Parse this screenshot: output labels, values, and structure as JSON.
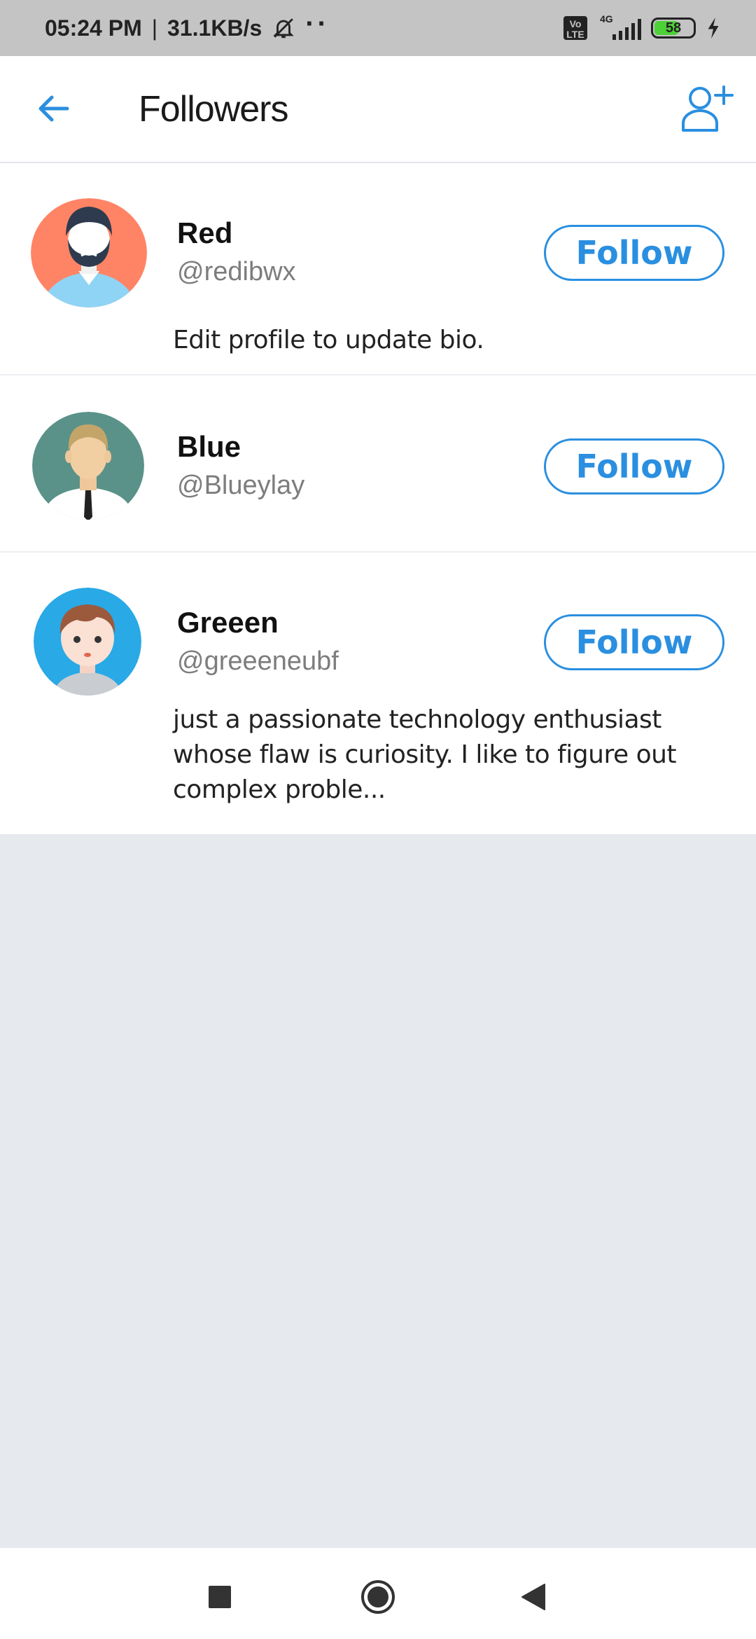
{
  "status_bar": {
    "time": "05:24 PM",
    "separator": "|",
    "speed": "31.1KB/s",
    "network": "4G",
    "volte": "Vo LTE",
    "battery": "58"
  },
  "header": {
    "title": "Followers"
  },
  "followers": [
    {
      "name": "Red",
      "handle": "@redibwx",
      "follow_label": "Follow",
      "bio": "Edit profile to update bio.",
      "avatar_color": "#ff8466"
    },
    {
      "name": "Blue",
      "handle": "@Blueylay",
      "follow_label": "Follow",
      "bio": "",
      "avatar_color": "#5a9289"
    },
    {
      "name": "Greeen",
      "handle": "@greeeneubf",
      "follow_label": "Follow",
      "bio": "just a passionate technology enthusiast whose flaw is curiosity. I like to figure out complex proble...",
      "avatar_color": "#29a9e6"
    }
  ],
  "colors": {
    "accent": "#2a8fe0",
    "background": "#e6eaee",
    "status_bar": "#c4c4c4"
  },
  "icons": {
    "back": "arrow-left-icon",
    "add_user": "add-user-icon",
    "nav_recent": "square-icon",
    "nav_home": "circle-icon",
    "nav_back": "triangle-back-icon"
  }
}
